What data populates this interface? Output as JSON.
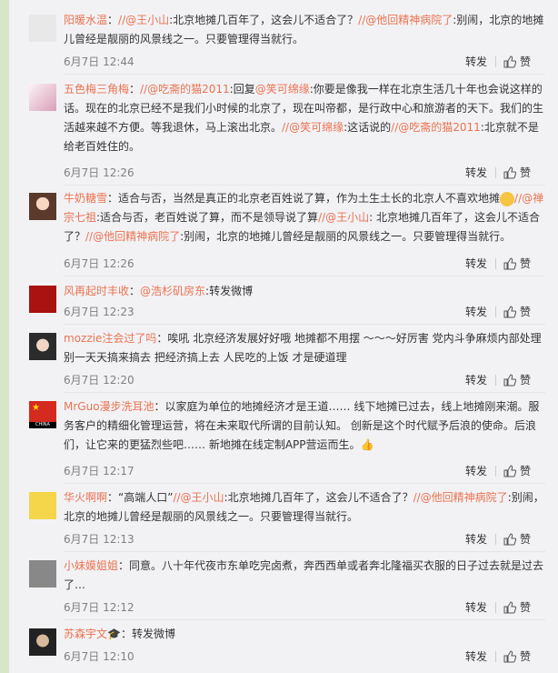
{
  "like_label": "赞",
  "forward_label": "转发",
  "comments": [
    {
      "user": "阳暖水温",
      "parts": [
        {
          "t": "text",
          "v": "："
        },
        {
          "t": "mention",
          "v": "//@王小山"
        },
        {
          "t": "text",
          "v": ":北京地摊几百年了，这会儿不适合了？"
        },
        {
          "t": "mention",
          "v": "//@他回精神病院了"
        },
        {
          "t": "text",
          "v": ":别闹，北京的地摊儿曾经是靓丽的风景线之一。只要管理得当就行。"
        }
      ],
      "time": "6月7日 12:44",
      "avatar": "default-avatar"
    },
    {
      "user": "五色梅三角梅",
      "parts": [
        {
          "t": "text",
          "v": "："
        },
        {
          "t": "mention",
          "v": "//@吃斋的猫2011"
        },
        {
          "t": "text",
          "v": ":回复"
        },
        {
          "t": "mention",
          "v": "@笑可绵缘"
        },
        {
          "t": "text",
          "v": ":你要是像我一样在北京生活几十年也会说这样的话。现在的北京已经不是我们小时候的北京了，现在叫帝都，是行政中心和旅游者的天下。我们的生活越来越不方便。等我退休，马上滚出北京。"
        },
        {
          "t": "mention",
          "v": "//@笑可绵缘"
        },
        {
          "t": "text",
          "v": ":这话说的"
        },
        {
          "t": "mention",
          "v": "//@吃斋的猫2011"
        },
        {
          "t": "text",
          "v": ":北京就不是给老百姓住的。"
        }
      ],
      "time": "6月7日 12:26",
      "avatar": "flower-avatar"
    },
    {
      "user": "牛奶糖雪",
      "parts": [
        {
          "t": "text",
          "v": "：适合与否，当然是真正的北京老百姓说了算，作为土生土长的北京人不喜欢地摊"
        },
        {
          "t": "emoji",
          "v": "smile-emoji"
        },
        {
          "t": "mention",
          "v": "//@禅宗七祖"
        },
        {
          "t": "text",
          "v": ":适合与否，老百姓说了算，而不是领导说了算"
        },
        {
          "t": "mention",
          "v": "//@王小山"
        },
        {
          "t": "text",
          "v": ": 北京地摊几百年了，这会儿不适合了？"
        },
        {
          "t": "mention",
          "v": "//@他回精神病院了"
        },
        {
          "t": "text",
          "v": ":别闹，北京的地摊儿曾经是靓丽的风景线之一。只要管理得当就行。"
        }
      ],
      "time": "6月7日 12:26",
      "avatar": "doll-avatar"
    },
    {
      "user": "风再起时丰收",
      "parts": [
        {
          "t": "text",
          "v": "："
        },
        {
          "t": "mention",
          "v": "@浩杉矶房东"
        },
        {
          "t": "text",
          "v": ":转发微博"
        }
      ],
      "time": "6月7日 12:23",
      "avatar": "red-avatar"
    },
    {
      "user": "mozzie注会过了吗",
      "parts": [
        {
          "t": "text",
          "v": "：唉吼 北京经济发展好好哦 地摊都不用摆 ～～～好厉害 党内斗争麻烦内部处理 别一天天搞来搞去 把经济搞上去 人民吃的上饭 才是硬道理"
        }
      ],
      "time": "6月7日 12:20",
      "avatar": "girl-avatar"
    },
    {
      "user": "MrGuo漫步洗耳池",
      "parts": [
        {
          "t": "text",
          "v": "：以家庭为单位的地摊经济才是王道…… 线下地摊已过去，线上地摊刚来潮。服务客户的精细化管理运营，将在未来取代所谓的目前认知。 创新是这个时代赋予后浪的使命。后浪们，让它来的更猛烈些吧…… 新地摊在线定制APP营运而生。"
        },
        {
          "t": "emoji",
          "v": "thumb-emoji"
        }
      ],
      "time": "6月7日 12:17",
      "avatar": "china-flag-avatar",
      "avatar_label": "CHINA"
    },
    {
      "user": "华火啊啊",
      "parts": [
        {
          "t": "text",
          "v": "：“高端人口”"
        },
        {
          "t": "mention",
          "v": "//@王小山"
        },
        {
          "t": "text",
          "v": ":北京地摊几百年了，这会儿不适合了？"
        },
        {
          "t": "mention",
          "v": "//@他回精神病院了"
        },
        {
          "t": "text",
          "v": ":别闹，北京的地摊儿曾经是靓丽的风景线之一。只要管理得当就行。"
        }
      ],
      "time": "6月7日 12:13",
      "avatar": "minion-avatar"
    },
    {
      "user": "小妹嫫姐姐",
      "parts": [
        {
          "t": "text",
          "v": "：同意。八十年代夜市东单吃完卤煮，奔西西单或者奔北隆福买衣服的日子过去就是过去了…"
        }
      ],
      "time": "6月7日 12:12",
      "avatar": "bw-avatar"
    },
    {
      "user": "苏森宇文",
      "parts": [
        {
          "t": "emoji",
          "v": "graduation-cap-emoji"
        },
        {
          "t": "text",
          "v": "：转发微博"
        }
      ],
      "time": "6月7日 12:10",
      "avatar": "man-avatar"
    }
  ],
  "colors": {
    "link": "#eb7350",
    "text": "#333333",
    "meta": "#808080",
    "page_bg": "#d9e5c9",
    "panel_bg": "#f2f2f5"
  }
}
